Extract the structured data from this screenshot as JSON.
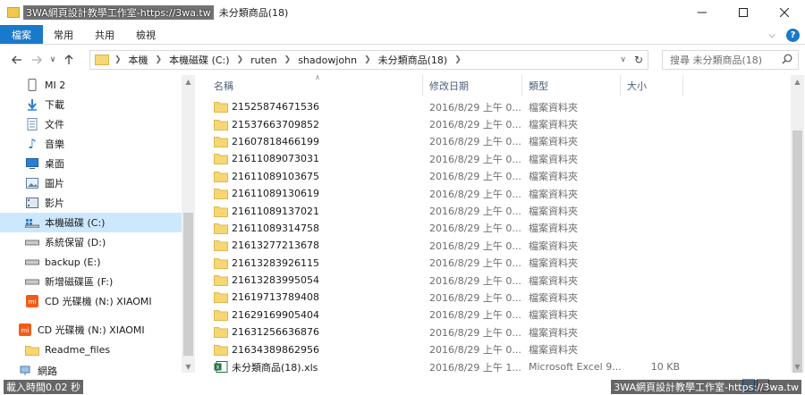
{
  "window": {
    "watermark": "3WA網頁設計教學工作室-https://3wa.tw",
    "title": "未分類商品(18)",
    "buttons": [
      "minimize",
      "maximize",
      "close"
    ]
  },
  "ribbon": {
    "tabs": [
      "檔案",
      "常用",
      "共用",
      "檢視"
    ]
  },
  "address": {
    "breadcrumbs": [
      "本機",
      "本機磁碟 (C:)",
      "ruten",
      "shadowjohn",
      "未分類商品(18)"
    ],
    "search_placeholder": "搜尋 未分類商品(18)"
  },
  "navpane": {
    "items": [
      {
        "label": "MI 2",
        "icon": "phone-icon"
      },
      {
        "label": "下載",
        "icon": "download-icon"
      },
      {
        "label": "文件",
        "icon": "document-icon"
      },
      {
        "label": "音樂",
        "icon": "music-icon"
      },
      {
        "label": "桌面",
        "icon": "desktop-icon"
      },
      {
        "label": "圖片",
        "icon": "pictures-icon"
      },
      {
        "label": "影片",
        "icon": "video-icon"
      },
      {
        "label": "本機磁碟 (C:)",
        "icon": "drive-icon",
        "selected": true
      },
      {
        "label": "系統保留 (D:)",
        "icon": "drive-icon"
      },
      {
        "label": "backup (E:)",
        "icon": "drive-icon"
      },
      {
        "label": "新增磁碟區 (F:)",
        "icon": "drive-icon"
      },
      {
        "label": "CD 光碟機 (N:) XIAOMI",
        "icon": "xiaomi-icon"
      },
      {
        "label": "CD 光碟機 (N:) XIAOMI",
        "icon": "xiaomi-icon"
      },
      {
        "label": "Readme_files",
        "icon": "folder-icon"
      },
      {
        "label": "網路",
        "icon": "network-icon"
      }
    ]
  },
  "columns": [
    "名稱",
    "修改日期",
    "類型",
    "大小"
  ],
  "files": [
    {
      "name": "21525874671536",
      "date": "2016/8/29 上午 0...",
      "type": "檔案資料夾",
      "size": ""
    },
    {
      "name": "21537663709852",
      "date": "2016/8/29 上午 0...",
      "type": "檔案資料夾",
      "size": ""
    },
    {
      "name": "21607818466199",
      "date": "2016/8/29 上午 0...",
      "type": "檔案資料夾",
      "size": ""
    },
    {
      "name": "21611089073031",
      "date": "2016/8/29 上午 0...",
      "type": "檔案資料夾",
      "size": ""
    },
    {
      "name": "21611089103675",
      "date": "2016/8/29 上午 0...",
      "type": "檔案資料夾",
      "size": ""
    },
    {
      "name": "21611089130619",
      "date": "2016/8/29 上午 0...",
      "type": "檔案資料夾",
      "size": ""
    },
    {
      "name": "21611089137021",
      "date": "2016/8/29 上午 0...",
      "type": "檔案資料夾",
      "size": ""
    },
    {
      "name": "21611089314758",
      "date": "2016/8/29 上午 0...",
      "type": "檔案資料夾",
      "size": ""
    },
    {
      "name": "21613277213678",
      "date": "2016/8/29 上午 0...",
      "type": "檔案資料夾",
      "size": ""
    },
    {
      "name": "21613283926115",
      "date": "2016/8/29 上午 0...",
      "type": "檔案資料夾",
      "size": ""
    },
    {
      "name": "21613283995054",
      "date": "2016/8/29 上午 0...",
      "type": "檔案資料夾",
      "size": ""
    },
    {
      "name": "21619713789408",
      "date": "2016/8/29 上午 0...",
      "type": "檔案資料夾",
      "size": ""
    },
    {
      "name": "21629169905404",
      "date": "2016/8/29 上午 0...",
      "type": "檔案資料夾",
      "size": ""
    },
    {
      "name": "21631256636876",
      "date": "2016/8/29 上午 0...",
      "type": "檔案資料夾",
      "size": ""
    },
    {
      "name": "21634389862956",
      "date": "2016/8/29 上午 0...",
      "type": "檔案資料夾",
      "size": ""
    },
    {
      "name": "未分類商品(18).xls",
      "date": "2016/8/29 上午 1...",
      "type": "Microsoft Excel 9...",
      "size": "10 KB",
      "kind": "excel"
    }
  ],
  "status": {
    "left": "載入時間0.02 秒",
    "right": "3WA網頁設計教學工作室-https://3wa.tw"
  },
  "colors": {
    "accent": "#1979ca",
    "selected": "#cce8ff",
    "folder": "#f7d774"
  }
}
